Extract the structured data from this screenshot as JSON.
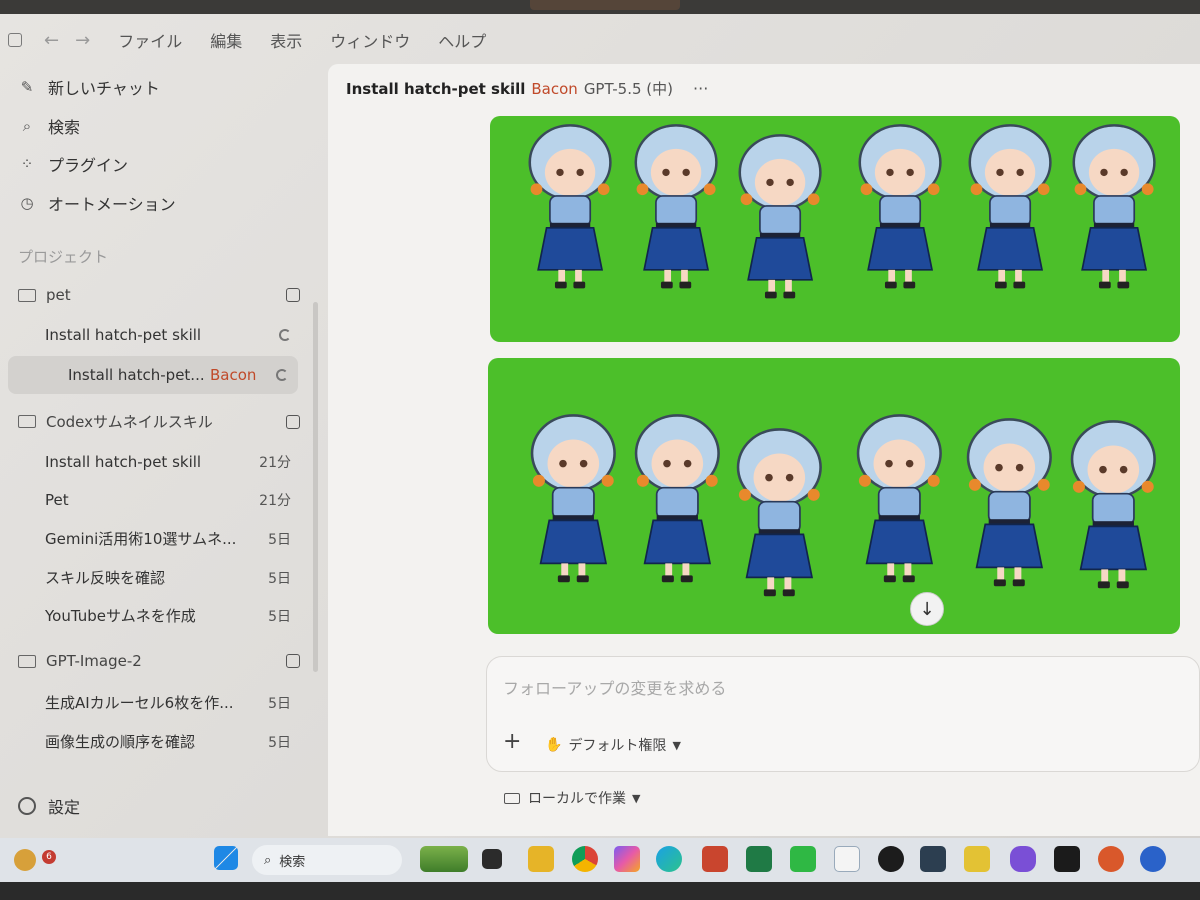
{
  "menubar": {
    "items": [
      "ファイル",
      "編集",
      "表示",
      "ウィンドウ",
      "ヘルプ"
    ]
  },
  "sidebar": {
    "top_items": [
      {
        "label": "新しいチャット",
        "icon": "compose-icon"
      },
      {
        "label": "検索",
        "icon": "search-icon"
      },
      {
        "label": "プラグイン",
        "icon": "grid-icon"
      },
      {
        "label": "オートメーション",
        "icon": "clock-icon"
      }
    ],
    "section_label": "プロジェクト",
    "projects": [
      {
        "name": "pet",
        "threads": [
          {
            "label": "Install hatch-pet skill",
            "meta": ""
          },
          {
            "label": "Install hatch-pet...",
            "tag": "Bacon",
            "active": true
          }
        ]
      },
      {
        "name": "Codexサムネイルスキル",
        "threads": [
          {
            "label": "Install hatch-pet skill",
            "meta": "21分"
          },
          {
            "label": "Pet",
            "meta": "21分"
          },
          {
            "label": "Gemini活用術10選サムネ...",
            "meta": "5日"
          },
          {
            "label": "スキル反映を確認",
            "meta": "5日"
          },
          {
            "label": "YouTubeサムネを作成",
            "meta": "5日"
          }
        ]
      },
      {
        "name": "GPT-Image-2",
        "threads": [
          {
            "label": "生成AIカルーセル6枚を作...",
            "meta": "5日"
          },
          {
            "label": "画像生成の順序を確認",
            "meta": "5日"
          }
        ]
      }
    ],
    "settings_label": "設定"
  },
  "main": {
    "title": "Install hatch-pet skill",
    "tag": "Bacon",
    "model": "GPT-5.5 (中)",
    "more": "···",
    "composer": {
      "placeholder": "フォローアップの変更を求める",
      "permission_label": "デフォルト権限",
      "local_label": "ローカルで作業"
    }
  },
  "taskbar": {
    "search_label": "検索",
    "notification_count": "6"
  },
  "colors": {
    "accent_tag": "#c04a2a",
    "image_background": "#4cbf2a",
    "hair": "#b9d3ea",
    "shirt": "#8fb5e0",
    "skirt": "#1f4a9a"
  }
}
